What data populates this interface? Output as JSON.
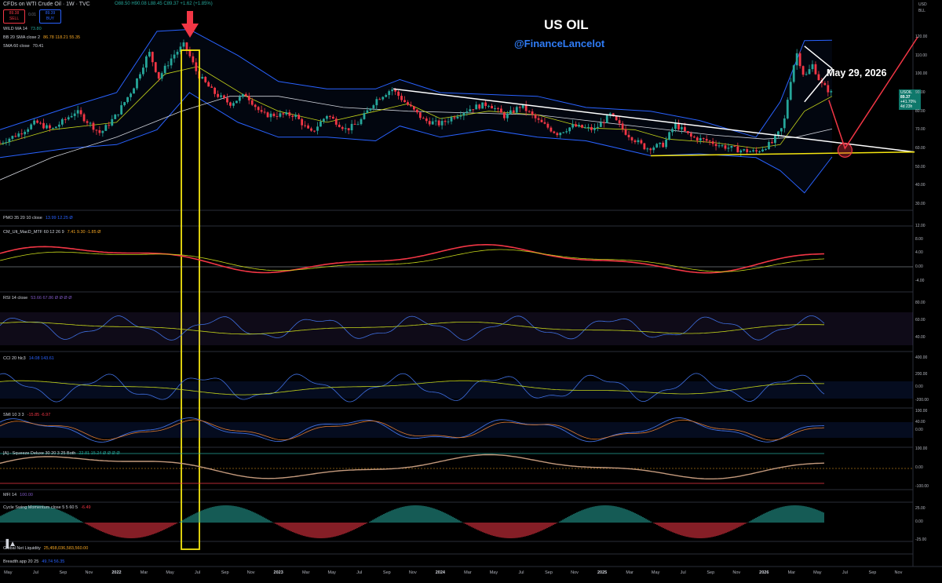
{
  "header": {
    "symbol_title": "CFDs on WTI Crude Oil · 1W · TVC",
    "ohlc": "O88.50 H90.08 L88.45 C89.37 +1.62 (+1.85%)",
    "sell_price": "89.38",
    "sell_label": "SELL",
    "spread": "0.01",
    "buy_price": "89.39",
    "buy_label": "BUY",
    "currency": "USD",
    "unit": "BLL"
  },
  "overlay_labels": {
    "wild_ma": {
      "name": "WILD MA 14",
      "value": "73.80"
    },
    "bb": {
      "name": "BB 20 SMA close 2",
      "values": "86.78  118.21  55.35"
    },
    "sma": {
      "name": "SMA 60 close",
      "value": "70.41"
    }
  },
  "annotations": {
    "title": "US OIL",
    "handle": "@FinanceLancelot",
    "date_note": "May 29, 2026"
  },
  "price_badge": {
    "symbol": "USOIL",
    "price": "89.37",
    "change": "+41.70%",
    "time": "4d 23h"
  },
  "indicators": [
    {
      "name": "PMO 35 20 10 close",
      "values": "13.99  12.25  Ø"
    },
    {
      "name": "CM_Ult_MacD_MTF 60 12 26 9",
      "values": "7.41  9.30  -1.85  Ø"
    },
    {
      "name": "RSI 14 close",
      "values": "53.66  67.86  Ø  Ø  Ø  Ø"
    },
    {
      "name": "CCI 20 hlc3",
      "values": "14.08  143.61"
    },
    {
      "name": "SMI 10 3 3",
      "values": "-15.85  -6.97"
    },
    {
      "name": "[A] - Squeeze Deluxe 30 20 3 25 Both",
      "values": "22.81  15.24  Ø  Ø  Ø  Ø"
    },
    {
      "name": "MFI 14",
      "values": "100.00"
    },
    {
      "name": "Cycle Swing Momentum close 5 5 60 5",
      "values": "-6.49"
    },
    {
      "name": "Global Net Liquidity",
      "values": "25,458,036,583,560.00"
    },
    {
      "name": "Breadth.app 20 25",
      "values": "49.74  56.35"
    }
  ],
  "colors": {
    "up": "#26a69a",
    "down": "#f23645",
    "bb_band": "#2962ff",
    "annotation_white": "#ffffff",
    "highlight_yellow": "#f5e50f",
    "arrow_red": "#f23645",
    "wildma": "#c6d61a",
    "sma60": "#d1d4dc",
    "handle_blue": "#2f7cf6"
  },
  "chart_data": [
    {
      "type": "candlestick",
      "title": "US OIL",
      "series_name": "CFDs on WTI Crude Oil · 1W · TVC",
      "x_ticks": [
        "May",
        "Jul",
        "Sep",
        "Nov",
        "2022",
        "Mar",
        "May",
        "Jul",
        "Sep",
        "Nov",
        "2023",
        "Mar",
        "May",
        "Jul",
        "Sep",
        "Nov",
        "2024",
        "Mar",
        "May",
        "Jul",
        "Sep",
        "Nov",
        "2025",
        "Mar",
        "May",
        "Jul",
        "Sep",
        "Nov",
        "2026",
        "Mar",
        "May",
        "Jul",
        "Sep",
        "Nov"
      ],
      "x_tick_dates": [
        2021.33,
        2021.5,
        2021.67,
        2021.83,
        2022.0,
        2022.17,
        2022.33,
        2022.5,
        2022.67,
        2022.83,
        2023.0,
        2023.17,
        2023.33,
        2023.5,
        2023.67,
        2023.83,
        2024.0,
        2024.17,
        2024.33,
        2024.5,
        2024.67,
        2024.83,
        2025.0,
        2025.17,
        2025.33,
        2025.5,
        2025.67,
        2025.83,
        2026.0,
        2026.17,
        2026.33,
        2026.5,
        2026.67,
        2026.83
      ],
      "y_ticks": [
        30,
        40,
        50,
        60,
        70,
        80,
        90,
        100,
        110,
        120
      ],
      "ylim": [
        25,
        128
      ],
      "xlim": [
        2021.28,
        2026.92
      ],
      "price_path": [
        [
          2021.28,
          63
        ],
        [
          2021.4,
          68
        ],
        [
          2021.5,
          74
        ],
        [
          2021.6,
          70
        ],
        [
          2021.75,
          80
        ],
        [
          2021.9,
          68
        ],
        [
          2022.0,
          78
        ],
        [
          2022.1,
          92
        ],
        [
          2022.2,
          112
        ],
        [
          2022.26,
          98
        ],
        [
          2022.35,
          110
        ],
        [
          2022.42,
          116
        ],
        [
          2022.5,
          100
        ],
        [
          2022.6,
          90
        ],
        [
          2022.7,
          84
        ],
        [
          2022.8,
          89
        ],
        [
          2022.9,
          78
        ],
        [
          2023.0,
          78
        ],
        [
          2023.1,
          78
        ],
        [
          2023.2,
          68
        ],
        [
          2023.3,
          78
        ],
        [
          2023.42,
          70
        ],
        [
          2023.5,
          74
        ],
        [
          2023.6,
          86
        ],
        [
          2023.7,
          92
        ],
        [
          2023.78,
          85
        ],
        [
          2023.9,
          75
        ],
        [
          2024.0,
          73
        ],
        [
          2024.1,
          78
        ],
        [
          2024.2,
          82
        ],
        [
          2024.3,
          84
        ],
        [
          2024.4,
          77
        ],
        [
          2024.5,
          83
        ],
        [
          2024.6,
          75
        ],
        [
          2024.72,
          68
        ],
        [
          2024.82,
          72
        ],
        [
          2024.95,
          70
        ],
        [
          2025.05,
          78
        ],
        [
          2025.15,
          68
        ],
        [
          2025.27,
          60
        ],
        [
          2025.38,
          62
        ],
        [
          2025.45,
          73
        ],
        [
          2025.55,
          66
        ],
        [
          2025.65,
          64
        ],
        [
          2025.75,
          61
        ],
        [
          2025.85,
          59
        ],
        [
          2025.95,
          58
        ],
        [
          2026.05,
          63
        ],
        [
          2026.12,
          72
        ],
        [
          2026.16,
          95
        ],
        [
          2026.2,
          112
        ],
        [
          2026.25,
          98
        ],
        [
          2026.3,
          105
        ],
        [
          2026.35,
          95
        ],
        [
          2026.42,
          89.37
        ]
      ],
      "wild_ma": [
        [
          2021.28,
          62
        ],
        [
          2021.6,
          70
        ],
        [
          2022.0,
          74
        ],
        [
          2022.3,
          100
        ],
        [
          2022.5,
          104
        ],
        [
          2022.8,
          88
        ],
        [
          2023.0,
          80
        ],
        [
          2023.3,
          74
        ],
        [
          2023.6,
          80
        ],
        [
          2023.8,
          84
        ],
        [
          2024.0,
          76
        ],
        [
          2024.3,
          80
        ],
        [
          2024.6,
          78
        ],
        [
          2024.9,
          71
        ],
        [
          2025.2,
          70
        ],
        [
          2025.4,
          65
        ],
        [
          2025.7,
          63
        ],
        [
          2025.95,
          60
        ],
        [
          2026.1,
          62
        ],
        [
          2026.25,
          80
        ],
        [
          2026.42,
          88
        ]
      ],
      "sma60": [
        [
          2021.28,
          43
        ],
        [
          2021.6,
          55
        ],
        [
          2022.0,
          66
        ],
        [
          2022.4,
          80
        ],
        [
          2022.7,
          88
        ],
        [
          2023.0,
          88
        ],
        [
          2023.4,
          82
        ],
        [
          2023.8,
          80
        ],
        [
          2024.2,
          79
        ],
        [
          2024.6,
          78
        ],
        [
          2024.9,
          75
        ],
        [
          2025.3,
          71
        ],
        [
          2025.7,
          67
        ],
        [
          2026.0,
          65
        ],
        [
          2026.2,
          66
        ],
        [
          2026.42,
          70.41
        ]
      ],
      "bb_upper": [
        [
          2021.28,
          70
        ],
        [
          2021.7,
          82
        ],
        [
          2022.0,
          90
        ],
        [
          2022.25,
          123
        ],
        [
          2022.45,
          124
        ],
        [
          2022.75,
          110
        ],
        [
          2023.0,
          96
        ],
        [
          2023.3,
          92
        ],
        [
          2023.6,
          92
        ],
        [
          2023.75,
          97
        ],
        [
          2024.0,
          90
        ],
        [
          2024.3,
          89
        ],
        [
          2024.6,
          88
        ],
        [
          2024.9,
          82
        ],
        [
          2025.3,
          80
        ],
        [
          2025.6,
          75
        ],
        [
          2025.95,
          66
        ],
        [
          2026.1,
          85
        ],
        [
          2026.25,
          118
        ],
        [
          2026.42,
          118.21
        ]
      ],
      "bb_lower": [
        [
          2021.28,
          55
        ],
        [
          2021.7,
          60
        ],
        [
          2022.0,
          62
        ],
        [
          2022.25,
          70
        ],
        [
          2022.45,
          90
        ],
        [
          2022.75,
          74
        ],
        [
          2023.0,
          66
        ],
        [
          2023.3,
          66
        ],
        [
          2023.6,
          64
        ],
        [
          2023.75,
          72
        ],
        [
          2024.0,
          66
        ],
        [
          2024.3,
          70
        ],
        [
          2024.6,
          66
        ],
        [
          2024.9,
          64
        ],
        [
          2025.3,
          56
        ],
        [
          2025.6,
          57
        ],
        [
          2025.95,
          55
        ],
        [
          2026.1,
          48
        ],
        [
          2026.25,
          36
        ],
        [
          2026.42,
          55.35
        ]
      ],
      "trendline_down": [
        [
          2023.71,
          92
        ],
        [
          2026.93,
          58
        ]
      ],
      "support_line": [
        [
          2025.3,
          56
        ],
        [
          2026.93,
          58
        ]
      ],
      "projection": [
        [
          2026.4,
          86
        ],
        [
          2026.5,
          60
        ],
        [
          2026.95,
          120
        ]
      ],
      "triangle": [
        [
          2026.25,
          115
        ],
        [
          2026.42,
          103
        ],
        [
          2026.25,
          85
        ]
      ],
      "target_circle": [
        2026.5,
        59
      ]
    }
  ],
  "x_axis_labels": [
    "May",
    "Jul",
    "Sep",
    "Nov",
    "2022",
    "Mar",
    "May",
    "Jul",
    "Sep",
    "Nov",
    "2023",
    "Mar",
    "May",
    "Jul",
    "Sep",
    "Nov",
    "2024",
    "Mar",
    "May",
    "Jul",
    "Sep",
    "Nov",
    "2025",
    "Mar",
    "May",
    "Jul",
    "Sep",
    "Nov",
    "2026",
    "Mar",
    "May",
    "Jul",
    "Sep",
    "Nov"
  ],
  "right_axis": {
    "price": [
      "120.00",
      "110.00",
      "100.00",
      "90.00",
      "80.00",
      "70.00",
      "60.00",
      "50.00",
      "40.00",
      "30.00"
    ],
    "macd": [
      "12.00",
      "8.00",
      "4.00",
      "0.00",
      "-4.00"
    ],
    "rsi": [
      "80.00",
      "60.00",
      "40.00"
    ],
    "cci": [
      "400.00",
      "200.00",
      "0.00",
      "-200.00"
    ],
    "smi": [
      "100.00",
      "40.00",
      "0.00"
    ],
    "squeeze": [
      "100.00",
      "0.00",
      "-100.00"
    ],
    "cycle": [
      "25.00",
      "0.00",
      "-25.00"
    ]
  }
}
